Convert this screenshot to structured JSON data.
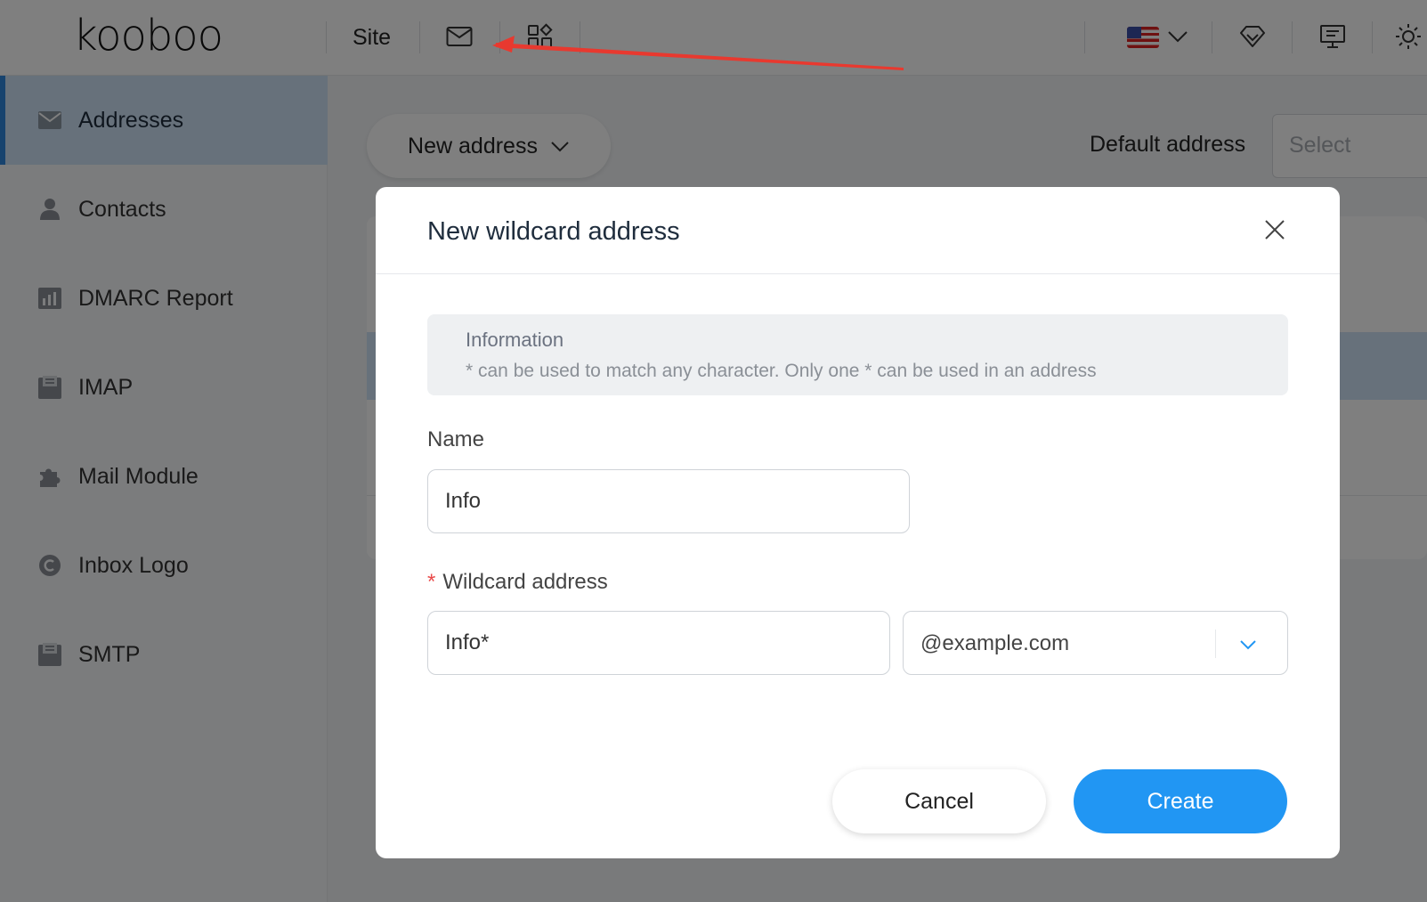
{
  "header": {
    "logo_text": "kooboo",
    "site_label": "Site",
    "icons": [
      "mail-icon",
      "apps-icon",
      "us-flag-icon",
      "chevron-down-icon",
      "diamond-icon",
      "presentation-icon",
      "sun-icon"
    ]
  },
  "sidebar": {
    "items": [
      {
        "label": "Addresses",
        "icon": "mail-icon",
        "active": true
      },
      {
        "label": "Contacts",
        "icon": "user-icon"
      },
      {
        "label": "DMARC Report",
        "icon": "chart-icon"
      },
      {
        "label": "IMAP",
        "icon": "inbox-icon"
      },
      {
        "label": "Mail Module",
        "icon": "puzzle-icon"
      },
      {
        "label": "Inbox Logo",
        "icon": "copyright-icon"
      },
      {
        "label": "SMTP",
        "icon": "inbox-icon"
      }
    ]
  },
  "main": {
    "new_address_label": "New address",
    "default_address_label": "Default address",
    "default_address_placeholder": "Select"
  },
  "modal": {
    "title": "New wildcard address",
    "info_title": "Information",
    "info_text": "* can be used to match any character. Only one * can be used in an address",
    "name_label": "Name",
    "name_value": "Info",
    "wildcard_label": "Wildcard address",
    "required_mark": "*",
    "wildcard_value": "Info*",
    "domain_value": "@example.com",
    "cancel_label": "Cancel",
    "create_label": "Create"
  },
  "colors": {
    "accent": "#2196f3",
    "sidebar_active": "#cfe3f7",
    "annotation_arrow": "#e8392f"
  }
}
